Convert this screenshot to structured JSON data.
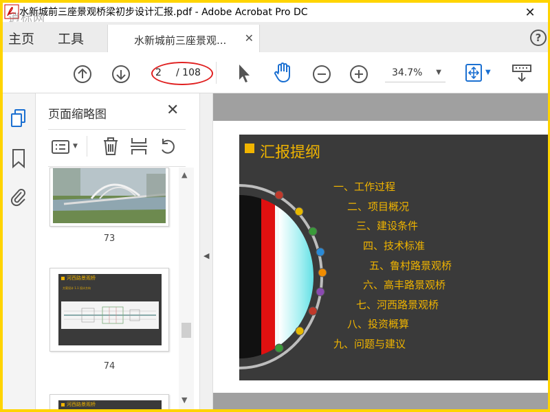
{
  "window": {
    "title": "水新城前三座景观桥梁初步设计汇报.pdf - Adobe Acrobat Pro DC",
    "watermark": "逍标网"
  },
  "tabs": {
    "home": "主页",
    "tools": "工具",
    "document": "水新城前三座景观..."
  },
  "toolbar": {
    "current_page": "2",
    "total_pages": "/ 108",
    "zoom": "34.7%"
  },
  "thumbnails": {
    "title": "页面缩略图",
    "items": [
      {
        "number": "73"
      },
      {
        "number": "74",
        "slide_title": "河西路景观桥",
        "slide_body": "方案设计 1.1 设计方向"
      },
      {
        "slide_title": "河西路景观桥"
      }
    ]
  },
  "slide": {
    "title": "汇报提纲",
    "outline": [
      "一、工作过程",
      "二、项目概况",
      "三、建设条件",
      "四、技术标准",
      "五、鲁村路景观桥",
      "六、高丰路景观桥",
      "七、河西路景观桥",
      "八、投资概算",
      "九、问题与建议"
    ]
  },
  "colors": {
    "accent_yellow": "#f0b400",
    "slide_bg": "#3a3a3a",
    "page_oval": "#e02020",
    "acrobat_blue": "#1a6fd1"
  }
}
